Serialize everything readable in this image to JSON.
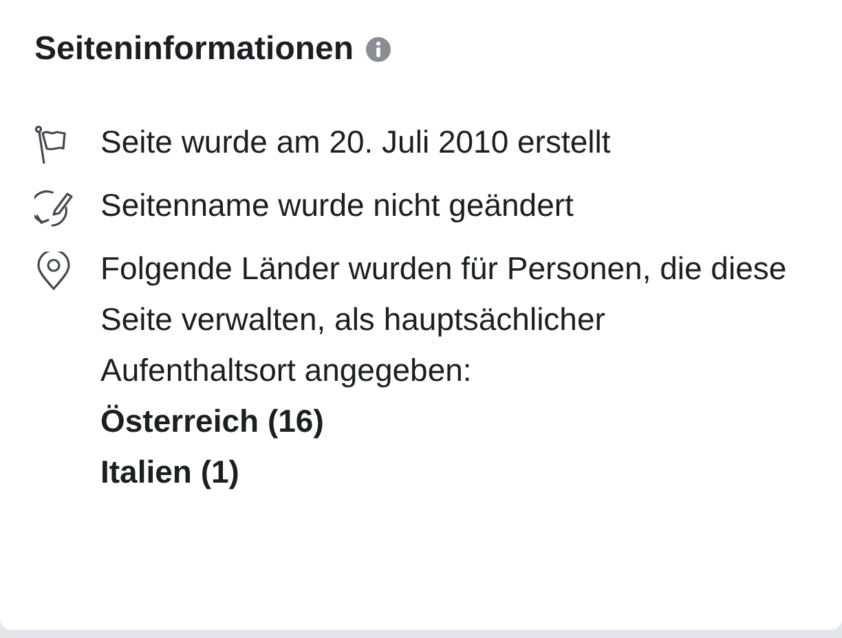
{
  "heading": "Seiteninformationen",
  "items": [
    {
      "kind": "flag",
      "text": "Seite wurde am 20. Juli 2010 erstellt"
    },
    {
      "kind": "rename",
      "text": "Seitenname wurde nicht geändert"
    },
    {
      "kind": "location",
      "text": "Folgende Länder wurden für Personen, die diese Seite verwalten, als hauptsächlicher Aufenthaltsort angegeben:",
      "entries": [
        "Österreich (16)",
        "Italien (1)"
      ]
    }
  ]
}
